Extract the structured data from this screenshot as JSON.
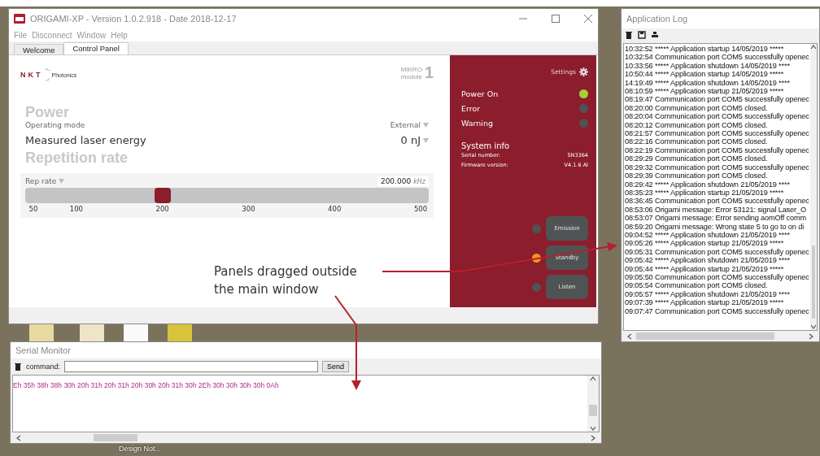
{
  "main_window": {
    "title": "ORIGAMI-XP - Version 1.0.2.918 - Date 2018-12-17",
    "menu": [
      "File",
      "Disconnect",
      "Window",
      "Help"
    ],
    "tabs": [
      {
        "label": "Welcome",
        "selected": false
      },
      {
        "label": "Control Panel",
        "selected": true
      }
    ],
    "logo": {
      "brand": "NKT",
      "sub": "Photonics"
    },
    "model": {
      "name": "MIKRO",
      "module_label": "module",
      "module_number": "1"
    },
    "power": {
      "heading": "Power",
      "operating_mode_label": "Operating mode",
      "operating_mode_value": "External",
      "energy_label": "Measured laser energy",
      "energy_value": "0 nJ"
    },
    "repetition": {
      "heading": "Repetition rate",
      "label": "Rep rate",
      "value": "200.000",
      "unit": "kHz",
      "level": 0.333,
      "ticks": [
        "50",
        "100",
        "200",
        "300",
        "400",
        "500"
      ]
    },
    "side_panel": {
      "settings": "Settings",
      "statuses": [
        {
          "label": "Power On",
          "color": "#a6ce39"
        },
        {
          "label": "Error",
          "color": "#4f5353"
        },
        {
          "label": "Warning",
          "color": "#4f5353"
        }
      ],
      "system_info": {
        "heading": "System info",
        "rows": [
          {
            "label": "Serial number:",
            "value": "SN3364"
          },
          {
            "label": "Firmware version:",
            "value": "V4.1.6 AI"
          }
        ]
      },
      "buttons": [
        {
          "label": "Emission",
          "color": "#4f5353"
        },
        {
          "label": "Standby",
          "color": "#f7941d"
        },
        {
          "label": "Listen",
          "color": "#4f5353"
        }
      ]
    }
  },
  "app_log": {
    "title": "Application Log",
    "lines": [
      "10:32:52 ***** Application startup 14/05/2019  *****",
      "10:32:54 Communication port COM5 successfully openec",
      "10:33:56 ***** Application shutdown 14/05/2019  ****",
      "10:50:44 ***** Application startup 14/05/2019  *****",
      "14:19:49 ***** Application shutdown 14/05/2019  ****",
      "08:10:59 ***** Application startup 21/05/2019  *****",
      "08:19:47 Communication port COM5 successfully openec",
      "08:20:00 Communication port COM5 closed.",
      "08:20:04 Communication port COM5 successfully openec",
      "08:20:12 Communication port COM5 closed.",
      "08:21:57 Communication port COM5 successfully openec",
      "08:22:16 Communication port COM5 closed.",
      "08:22:19 Communication port COM5 successfully openec",
      "08:29:29 Communication port COM5 closed.",
      "08:29:32 Communication port COM5 successfully openec",
      "08:29:39 Communication port COM5 closed.",
      "08:29:42 ***** Application shutdown 21/05/2019  ****",
      "08:35:23 ***** Application startup 21/05/2019  *****",
      "08:36:45 Communication port COM5 successfully openec",
      "08:53:06 Origami message: Error 53121: signal Laser_O",
      "08:53:07 Origami message: Error sending aomOff comm",
      "08:59:20 Origami message: Wrong state 5 to go to on di",
      "09:04:52 ***** Application shutdown 21/05/2019  ****",
      "09:05:26 ***** Application startup 21/05/2019  *****",
      "09:05:31 Communication port COM5 successfully openec",
      "09:05:42 ***** Application shutdown 21/05/2019  ****",
      "09:05:44 ***** Application startup 21/05/2019  *****",
      "09:05:50 Communication port COM5 successfully openec",
      "09:05:54 Communication port COM5 closed.",
      "09:05:57 ***** Application shutdown 21/05/2019  ****",
      "09:07:39 ***** Application startup 21/05/2019  *****",
      "09:07:47 Communication port COM5 successfully openec"
    ]
  },
  "serial_monitor": {
    "title": "Serial Monitor",
    "command_label": "command:",
    "send": "Send",
    "output": "Eh 35h 38h 38h 30h 20h 31h 20h 31h 20h 30h 20h 31h 30h 2Eh 30h 30h 30h 30h 0Ah"
  },
  "desktop": {
    "shortcut_label": "Design Not..."
  },
  "annotation": {
    "lines": [
      "Panels dragged outside",
      "the main window"
    ]
  }
}
